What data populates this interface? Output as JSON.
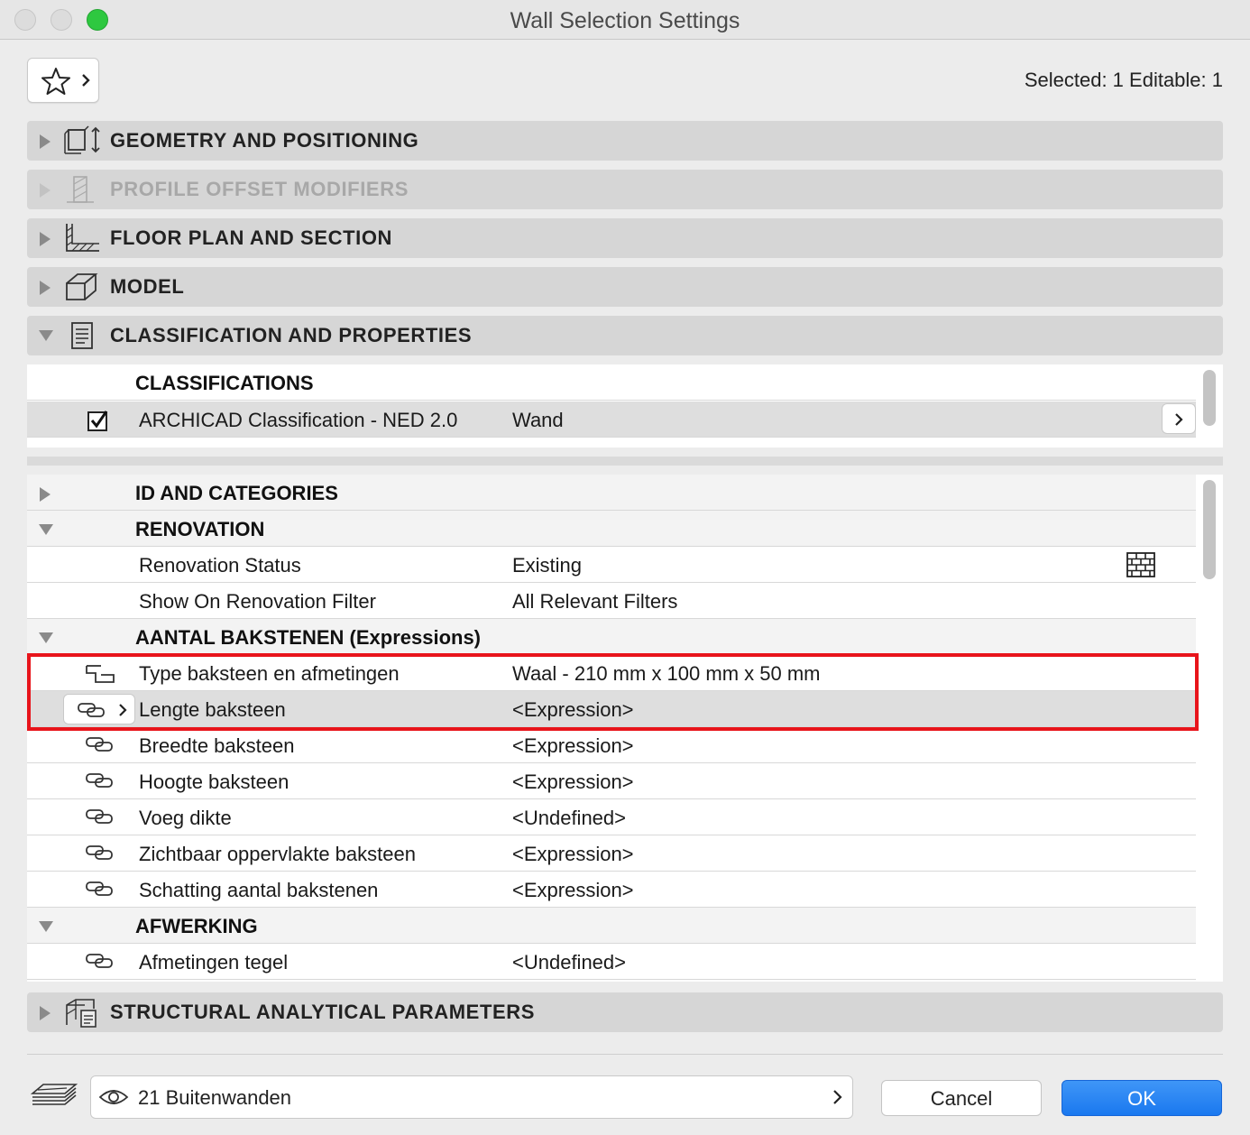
{
  "window": {
    "title": "Wall Selection Settings"
  },
  "header": {
    "favorites_icon": "star-icon",
    "selected_info": "Selected: 1 Editable: 1"
  },
  "panels": {
    "geometry": {
      "label": "GEOMETRY AND POSITIONING",
      "icon": "geometry-icon"
    },
    "profile": {
      "label": "PROFILE OFFSET MODIFIERS",
      "icon": "profile-icon"
    },
    "floor": {
      "label": "FLOOR PLAN AND SECTION",
      "icon": "floor-plan-icon"
    },
    "model": {
      "label": "MODEL",
      "icon": "model-box-icon"
    },
    "classification": {
      "label": "CLASSIFICATION AND PROPERTIES",
      "icon": "document-icon"
    },
    "structural": {
      "label": "STRUCTURAL ANALYTICAL PARAMETERS",
      "icon": "structural-icon"
    }
  },
  "classifications": {
    "header": "CLASSIFICATIONS",
    "row": {
      "name": "ARCHICAD Classification - NED 2.0",
      "value": "Wand",
      "checked": true
    }
  },
  "properties": {
    "id_categories": "ID AND CATEGORIES",
    "renovation": {
      "header": "RENOVATION",
      "rows": [
        {
          "name": "Renovation Status",
          "value": "Existing"
        },
        {
          "name": "Show On Renovation Filter",
          "value": "All Relevant Filters"
        }
      ]
    },
    "bricks": {
      "header": "AANTAL BAKSTENEN (Expressions)",
      "rows": [
        {
          "name": "Type baksteen en afmetingen",
          "value": "Waal - 210 mm x 100 mm x 50 mm"
        },
        {
          "name": "Lengte baksteen",
          "value": "<Expression>"
        },
        {
          "name": "Breedte baksteen",
          "value": "<Expression>"
        },
        {
          "name": "Hoogte baksteen",
          "value": "<Expression>"
        },
        {
          "name": "Voeg dikte",
          "value": "<Undefined>"
        },
        {
          "name": "Zichtbaar oppervlakte baksteen",
          "value": "<Expression>"
        },
        {
          "name": "Schatting aantal bakstenen",
          "value": "<Expression>"
        }
      ]
    },
    "afwerking": {
      "header": "AFWERKING",
      "rows": [
        {
          "name": "Afmetingen tegel",
          "value": "<Undefined>"
        }
      ]
    }
  },
  "footer": {
    "layer": "21 Buitenwanden",
    "cancel": "Cancel",
    "ok": "OK"
  },
  "colors": {
    "highlight_border": "#e8141b",
    "ok_button": "#1a78ef",
    "panel_bg": "#d6d6d6"
  }
}
